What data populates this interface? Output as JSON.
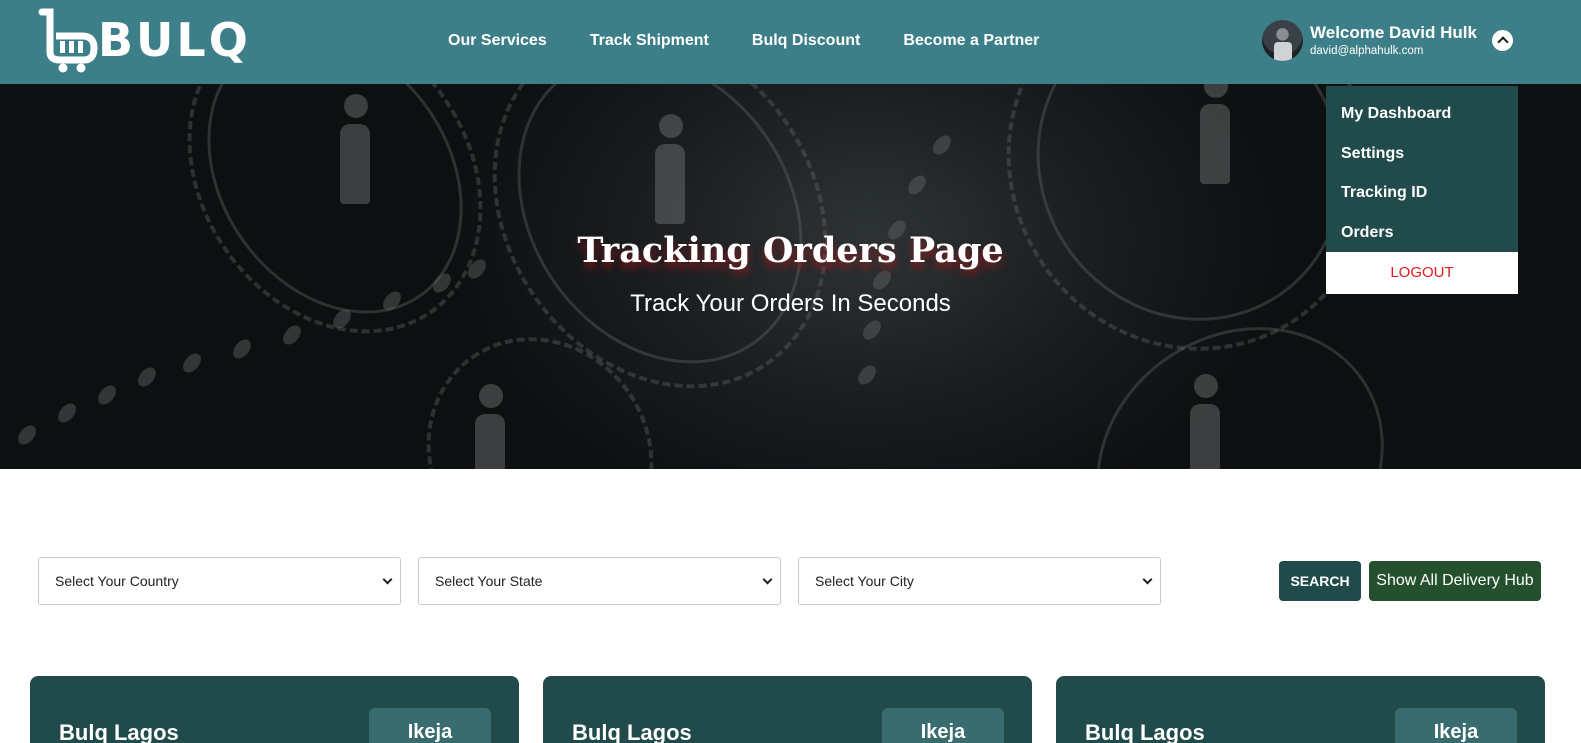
{
  "brand": {
    "logo_text": "BULQ"
  },
  "nav": {
    "items": [
      "Our Services",
      "Track Shipment",
      "Bulq Discount",
      "Become a Partner"
    ]
  },
  "user": {
    "welcome": "Welcome David Hulk",
    "email": "david@alphahulk.com"
  },
  "dropdown": {
    "items": [
      "My Dashboard",
      "Settings",
      "Tracking ID",
      "Orders"
    ],
    "logout": "LOGOUT"
  },
  "hero": {
    "title": "Tracking Orders Page",
    "subtitle": "Track Your Orders In Seconds"
  },
  "filters": {
    "country": "Select Your Country",
    "state": "Select Your State",
    "city": "Select Your City",
    "search_label": "SEARCH",
    "show_all_label": "Show All Delivery Hub"
  },
  "cards": [
    {
      "name": "Bulq Lagos",
      "tag": "Ikeja"
    },
    {
      "name": "Bulq Lagos",
      "tag": "Ikeja"
    },
    {
      "name": "Bulq Lagos",
      "tag": "Ikeja"
    }
  ],
  "colors": {
    "header": "#3d7f88",
    "dark_teal": "#214a4a",
    "hub_green": "#25502d",
    "logout_red": "#e21a1a"
  }
}
